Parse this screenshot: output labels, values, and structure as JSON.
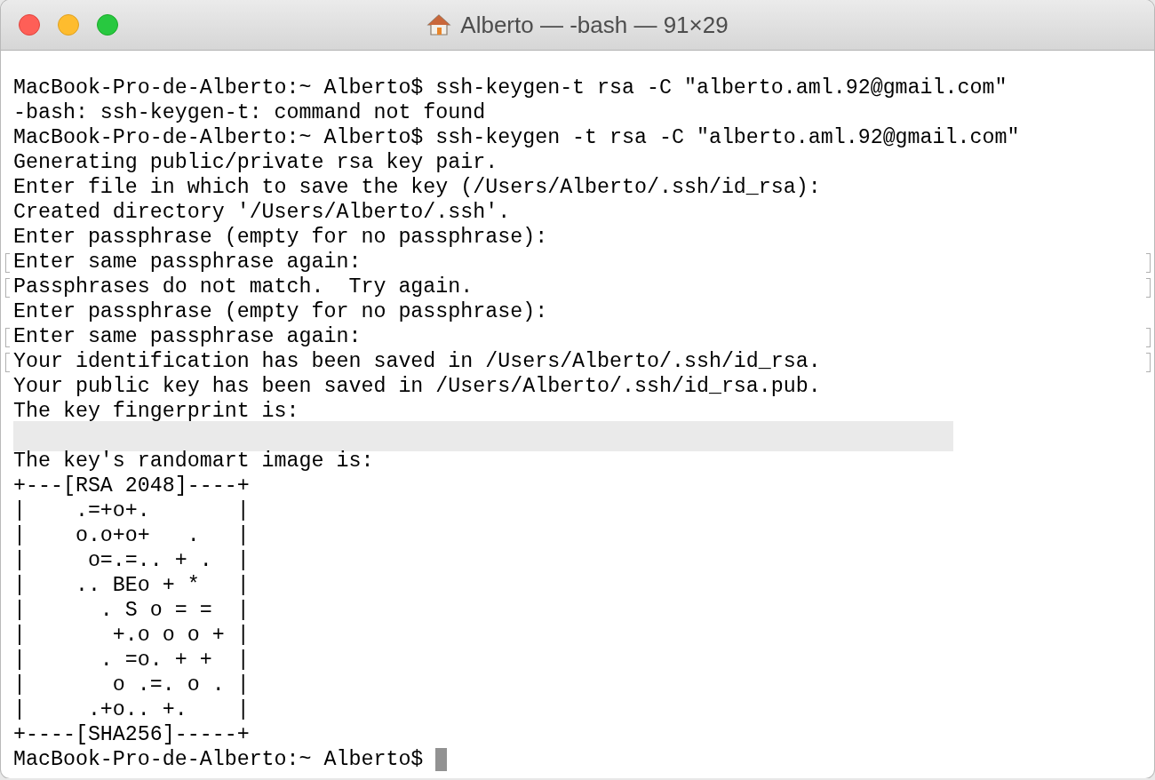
{
  "window": {
    "title": "Alberto — -bash — 91×29"
  },
  "terminal": {
    "lines": [
      {
        "kind": "blank",
        "marked": false
      },
      {
        "kind": "text",
        "text": "MacBook-Pro-de-Alberto:~ Alberto$ ssh-keygen-t rsa -C \"alberto.aml.92@gmail.com\"",
        "marked": false
      },
      {
        "kind": "text",
        "text": "-bash: ssh-keygen-t: command not found",
        "marked": false
      },
      {
        "kind": "text",
        "text": "MacBook-Pro-de-Alberto:~ Alberto$ ssh-keygen -t rsa -C \"alberto.aml.92@gmail.com\"",
        "marked": false
      },
      {
        "kind": "text",
        "text": "Generating public/private rsa key pair.",
        "marked": false
      },
      {
        "kind": "text",
        "text": "Enter file in which to save the key (/Users/Alberto/.ssh/id_rsa):",
        "marked": false
      },
      {
        "kind": "text",
        "text": "Created directory '/Users/Alberto/.ssh'.",
        "marked": false
      },
      {
        "kind": "text",
        "text": "Enter passphrase (empty for no passphrase):",
        "marked": false
      },
      {
        "kind": "text",
        "text": "Enter same passphrase again:",
        "marked": true
      },
      {
        "kind": "text",
        "text": "Passphrases do not match.  Try again.",
        "marked": true
      },
      {
        "kind": "text",
        "text": "Enter passphrase (empty for no passphrase):",
        "marked": false
      },
      {
        "kind": "text",
        "text": "Enter same passphrase again:",
        "marked": true
      },
      {
        "kind": "text",
        "text": "Your identification has been saved in /Users/Alberto/.ssh/id_rsa.",
        "marked": true
      },
      {
        "kind": "text",
        "text": "Your public key has been saved in /Users/Alberto/.ssh/id_rsa.pub.",
        "marked": false
      },
      {
        "kind": "text",
        "text": "The key fingerprint is:",
        "marked": false
      },
      {
        "kind": "redacted",
        "marked": false
      },
      {
        "kind": "text",
        "text": "The key's randomart image is:",
        "marked": false
      },
      {
        "kind": "text",
        "text": "+---[RSA 2048]----+",
        "marked": false
      },
      {
        "kind": "text",
        "text": "|    .=+o+.       |",
        "marked": false
      },
      {
        "kind": "text",
        "text": "|    o.o+o+   .   |",
        "marked": false
      },
      {
        "kind": "text",
        "text": "|     o=.=.. + .  |",
        "marked": false
      },
      {
        "kind": "text",
        "text": "|    .. BEo + *   |",
        "marked": false
      },
      {
        "kind": "text",
        "text": "|      . S o = =  |",
        "marked": false
      },
      {
        "kind": "text",
        "text": "|       +.o o o + |",
        "marked": false
      },
      {
        "kind": "text",
        "text": "|      . =o. + +  |",
        "marked": false
      },
      {
        "kind": "text",
        "text": "|       o .=. o . |",
        "marked": false
      },
      {
        "kind": "text",
        "text": "|     .+o.. +.    |",
        "marked": false
      },
      {
        "kind": "text",
        "text": "+----[SHA256]-----+",
        "marked": false
      },
      {
        "kind": "prompt",
        "text": "MacBook-Pro-de-Alberto:~ Alberto$",
        "marked": false
      }
    ]
  }
}
